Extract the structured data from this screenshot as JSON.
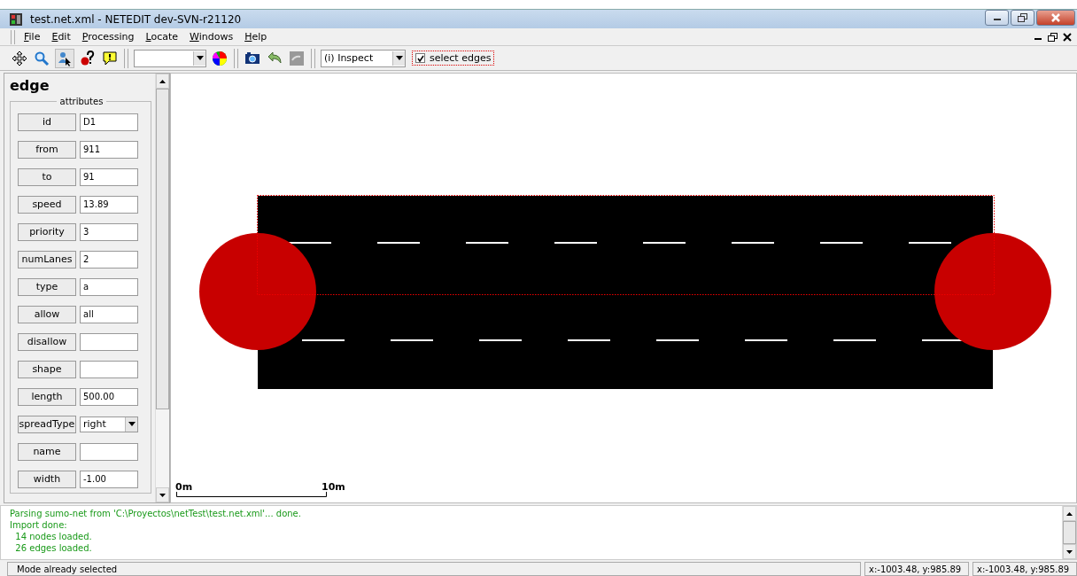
{
  "window": {
    "title": "test.net.xml - NETEDIT dev-SVN-r21120"
  },
  "menu": [
    "File",
    "Edit",
    "Processing",
    "Locate",
    "Windows",
    "Help"
  ],
  "toolbar": {
    "mode": "(i) Inspect",
    "select_edges": {
      "label": "select edges",
      "checked": true
    }
  },
  "panel": {
    "title": "edge",
    "group": "attributes",
    "attributes": [
      {
        "label": "id",
        "value": "D1",
        "kind": "text"
      },
      {
        "label": "from",
        "value": "911",
        "kind": "text"
      },
      {
        "label": "to",
        "value": "91",
        "kind": "text"
      },
      {
        "label": "speed",
        "value": "13.89",
        "kind": "text"
      },
      {
        "label": "priority",
        "value": "3",
        "kind": "text"
      },
      {
        "label": "numLanes",
        "value": "2",
        "kind": "text"
      },
      {
        "label": "type",
        "value": "a",
        "kind": "text"
      },
      {
        "label": "allow",
        "value": "all",
        "kind": "text"
      },
      {
        "label": "disallow",
        "kind": "text"
      },
      {
        "label": "shape",
        "kind": "text"
      },
      {
        "label": "length",
        "value": "500.00",
        "kind": "text"
      },
      {
        "label": "spreadType",
        "value": "right",
        "kind": "dropdown"
      },
      {
        "label": "name",
        "kind": "text"
      },
      {
        "label": "width",
        "value": "-1.00",
        "kind": "text"
      }
    ]
  },
  "canvas": {
    "scale_start": "0m",
    "scale_end": "10m"
  },
  "log": [
    "Parsing sumo-net from 'C:\\Proyectos\\netTest\\test.net.xml'... done.",
    "Import done:",
    "  14 nodes loaded.",
    "  26 edges loaded."
  ],
  "status_bar": {
    "message": "Mode already selected",
    "coordinates": [
      "x:-1003.48, y:985.89",
      "x:-1003.48, y:985.89"
    ]
  }
}
